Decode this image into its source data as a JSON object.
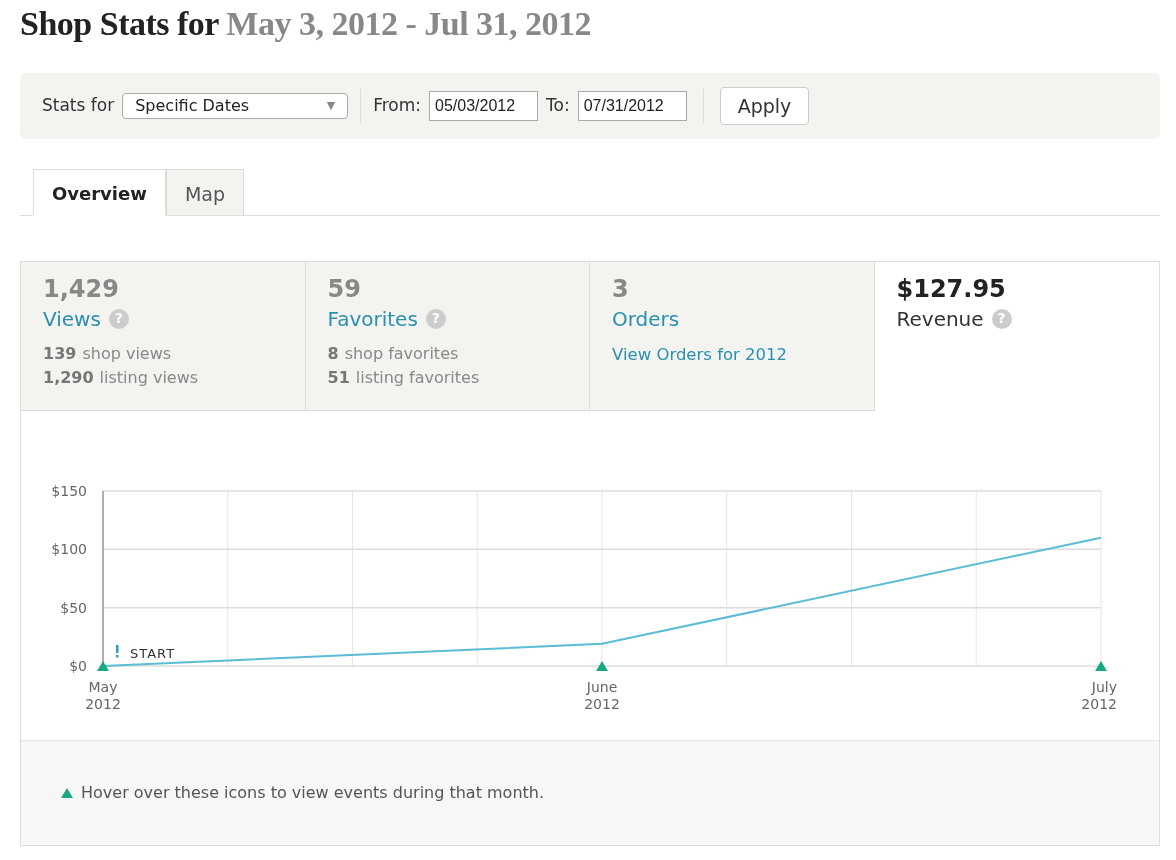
{
  "title": {
    "prefix": "Shop Stats for",
    "range": "May 3, 2012 - Jul 31, 2012"
  },
  "filter": {
    "label": "Stats for",
    "select": "Specific Dates",
    "select_caret": "▼",
    "from_label": "From:",
    "from": "05/03/2012",
    "to_label": "To:",
    "to": "07/31/2012",
    "apply": "Apply"
  },
  "tabs": [
    {
      "label": "Overview",
      "selected": true
    },
    {
      "label": "Map",
      "selected": false
    }
  ],
  "stats": [
    {
      "value": "1,429",
      "label": "Views",
      "help": "?",
      "selected": false,
      "details": [
        {
          "count": "139",
          "text": "shop views"
        },
        {
          "count": "1,290",
          "text": "listing views"
        }
      ]
    },
    {
      "value": "59",
      "label": "Favorites",
      "help": "?",
      "selected": false,
      "details": [
        {
          "count": "8",
          "text": "shop favorites"
        },
        {
          "count": "51",
          "text": "listing favorites"
        }
      ]
    },
    {
      "value": "3",
      "label": "Orders",
      "selected": false,
      "link": "View Orders for 2012"
    },
    {
      "value": "$127.95",
      "label": "Revenue",
      "help": "?",
      "selected": true
    }
  ],
  "chart_data": {
    "type": "line",
    "categories": [
      "May 2012",
      "June 2012",
      "July 2012"
    ],
    "series": [
      {
        "color": "#5bbcd6",
        "values": [
          0,
          19,
          110
        ]
      }
    ],
    "grid": true,
    "ylim": [
      0,
      150
    ],
    "yticks": [
      {
        "value": 0,
        "label": "$0"
      },
      {
        "value": 50,
        "label": "$50"
      },
      {
        "value": 100,
        "label": "$100"
      },
      {
        "value": 150,
        "label": "$150"
      }
    ],
    "annotations": [
      {
        "x": "May 2012",
        "y": 0,
        "text": "START"
      }
    ]
  },
  "legend": "Hover over these icons to view events during that month."
}
